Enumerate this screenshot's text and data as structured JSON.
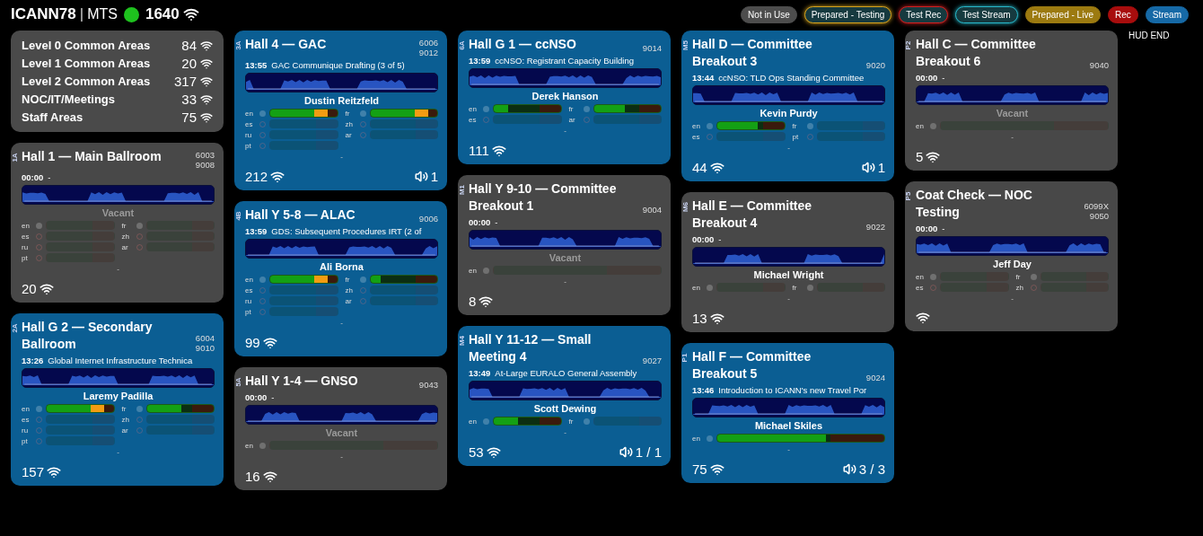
{
  "header": {
    "title": "ICANN78",
    "separator": "|",
    "subtitle": "MTS",
    "online": true,
    "count": "1640"
  },
  "legend": [
    {
      "label": "Not in Use",
      "kind": "filled",
      "color": "#4d4d4d"
    },
    {
      "label": "Prepared - Testing",
      "kind": "outlined",
      "color": "#d6a21c"
    },
    {
      "label": "Test Rec",
      "kind": "outlined",
      "color": "#d42020"
    },
    {
      "label": "Test Stream",
      "kind": "outlined",
      "color": "#27b7c9"
    },
    {
      "label": "Prepared - Live",
      "kind": "filled",
      "color": "#9c7a10"
    },
    {
      "label": "Rec",
      "kind": "filled",
      "color": "#a80d0d"
    },
    {
      "label": "Stream",
      "kind": "filled",
      "color": "#1669a6"
    }
  ],
  "summary": [
    {
      "label": "Level 0 Common Areas",
      "count": "84"
    },
    {
      "label": "Level 1 Common Areas",
      "count": "20"
    },
    {
      "label": "Level 2 Common Areas",
      "count": "317"
    },
    {
      "label": "NOC/IT/Meetings",
      "count": "33"
    },
    {
      "label": "Staff Areas",
      "count": "75"
    }
  ],
  "columns": [
    {
      "rooms": [
        {
          "code": "1A",
          "title": "Hall 1 — Main Ballroom",
          "ids": [
            "6003",
            "9008"
          ],
          "live": false,
          "time": "00:00",
          "session": "-",
          "presenter": "Vacant",
          "vacant": true,
          "channels": [
            {
              "lang": "en",
              "enabled": true
            },
            {
              "lang": "fr",
              "enabled": true
            },
            {
              "lang": "es",
              "enabled": false
            },
            {
              "lang": "zh",
              "enabled": false
            },
            {
              "lang": "ru",
              "enabled": false
            },
            {
              "lang": "ar",
              "enabled": false
            },
            {
              "lang": "pt",
              "enabled": false
            }
          ],
          "note": "-",
          "count": "20"
        },
        {
          "code": "2A",
          "title": "Hall G 2 — Secondary Ballroom",
          "ids": [
            "6004",
            "9010"
          ],
          "live": true,
          "time": "13:26",
          "session": "Global Internet Infrastructure Technica",
          "presenter": "Laremy Padilla",
          "vacant": false,
          "channels": [
            {
              "lang": "en",
              "enabled": true,
              "level": 0.66,
              "clipping": true
            },
            {
              "lang": "fr",
              "enabled": true,
              "level": 0.52
            },
            {
              "lang": "es",
              "enabled": false
            },
            {
              "lang": "zh",
              "enabled": false
            },
            {
              "lang": "ru",
              "enabled": false
            },
            {
              "lang": "ar",
              "enabled": false
            },
            {
              "lang": "pt",
              "enabled": false
            }
          ],
          "note": "-",
          "count": "157"
        }
      ]
    },
    {
      "rooms": [
        {
          "code": "3A",
          "title": "Hall 4 — GAC",
          "ids": [
            "6006",
            "9012"
          ],
          "live": true,
          "time": "13:55",
          "session": "GAC Communique Drafting (3 of 5)",
          "presenter": "Dustin Reitzfeld",
          "vacant": false,
          "channels": [
            {
              "lang": "en",
              "enabled": true,
              "level": 0.66,
              "clipping": true
            },
            {
              "lang": "fr",
              "enabled": true,
              "level": 0.66,
              "clipping": true
            },
            {
              "lang": "es",
              "enabled": false
            },
            {
              "lang": "zh",
              "enabled": false
            },
            {
              "lang": "ru",
              "enabled": false
            },
            {
              "lang": "ar",
              "enabled": false
            },
            {
              "lang": "pt",
              "enabled": false
            }
          ],
          "note": "-",
          "count": "212",
          "audio": "1"
        },
        {
          "code": "4B",
          "title": "Hall Y 5-8 — ALAC",
          "ids": [
            "9006"
          ],
          "live": true,
          "time": "13:59",
          "session": "GDS: Subsequent Procedures IRT (2 of",
          "presenter": "Ali Borna",
          "vacant": false,
          "channels": [
            {
              "lang": "en",
              "enabled": true,
              "level": 0.66,
              "clipping": true
            },
            {
              "lang": "fr",
              "enabled": true,
              "level": 0.16
            },
            {
              "lang": "es",
              "enabled": false
            },
            {
              "lang": "zh",
              "enabled": false
            },
            {
              "lang": "ru",
              "enabled": false
            },
            {
              "lang": "ar",
              "enabled": false
            },
            {
              "lang": "pt",
              "enabled": false
            }
          ],
          "note": "-",
          "count": "99"
        },
        {
          "code": "5A",
          "title": "Hall Y 1-4 — GNSO",
          "ids": [
            "9043"
          ],
          "live": false,
          "time": "00:00",
          "session": "-",
          "presenter": "Vacant",
          "vacant": true,
          "channels": [
            {
              "lang": "en",
              "enabled": true
            }
          ],
          "note": "-",
          "count": "16"
        }
      ]
    },
    {
      "rooms": [
        {
          "code": "6A",
          "title": "Hall G 1 — ccNSO",
          "ids": [
            "9014"
          ],
          "live": true,
          "time": "13:59",
          "session": "ccNSO: Registrant Capacity Building",
          "presenter": "Derek Hanson",
          "vacant": false,
          "channels": [
            {
              "lang": "en",
              "enabled": true,
              "level": 0.22
            },
            {
              "lang": "fr",
              "enabled": true,
              "level": 0.46
            },
            {
              "lang": "es",
              "enabled": false
            },
            {
              "lang": "ar",
              "enabled": false
            }
          ],
          "note": "-",
          "count": "111"
        },
        {
          "code": "M1",
          "title": "Hall Y 9-10 — Committee Breakout 1",
          "ids": [
            "9004"
          ],
          "live": false,
          "time": "00:00",
          "session": "-",
          "presenter": "Vacant",
          "vacant": true,
          "channels": [
            {
              "lang": "en",
              "enabled": true
            }
          ],
          "note": "-",
          "count": "8"
        },
        {
          "code": "M4",
          "title": "Hall Y 11-12 — Small Meeting 4",
          "ids": [
            "9027"
          ],
          "live": true,
          "time": "13:49",
          "session": "At-Large EURALO General Assembly",
          "presenter": "Scott Dewing",
          "vacant": false,
          "channels": [
            {
              "lang": "en",
              "enabled": true,
              "level": 0.36
            },
            {
              "lang": "fr",
              "enabled": true
            }
          ],
          "note": "-",
          "count": "53",
          "audio": "1 / 1"
        }
      ]
    },
    {
      "rooms": [
        {
          "code": "M5",
          "title": "Hall D — Committee Breakout 3",
          "ids": [
            "9020"
          ],
          "live": true,
          "time": "13:44",
          "session": "ccNSO: TLD Ops Standing Committee",
          "presenter": "Kevin Purdy",
          "vacant": false,
          "channels": [
            {
              "lang": "en",
              "enabled": true,
              "level": 0.6
            },
            {
              "lang": "fr",
              "enabled": true
            },
            {
              "lang": "es",
              "enabled": false
            },
            {
              "lang": "pt",
              "enabled": false
            }
          ],
          "note": "-",
          "count": "44",
          "audio": "1"
        },
        {
          "code": "M6",
          "title": "Hall E — Committee Breakout 4",
          "ids": [
            "9022"
          ],
          "live": false,
          "time": "00:00",
          "session": "-",
          "presenter": "Michael Wright",
          "vacant": false,
          "channels": [
            {
              "lang": "en",
              "enabled": true
            },
            {
              "lang": "fr",
              "enabled": true
            }
          ],
          "note": "-",
          "count": "13"
        },
        {
          "code": "P1",
          "title": "Hall F — Committee Breakout 5",
          "ids": [
            "9024"
          ],
          "live": true,
          "time": "13:46",
          "session": "Introduction to ICANN's new Travel Por",
          "presenter": "Michael Skiles",
          "vacant": false,
          "channels": [
            {
              "lang": "en",
              "enabled": true,
              "level": 0.65
            }
          ],
          "note": "-",
          "count": "75",
          "audio": "3 / 3"
        }
      ]
    },
    {
      "rooms": [
        {
          "code": "P2",
          "title": "Hall C — Committee Breakout 6",
          "ids": [
            "9040"
          ],
          "live": false,
          "time": "00:00",
          "session": "-",
          "presenter": "Vacant",
          "vacant": true,
          "channels": [
            {
              "lang": "en",
              "enabled": true
            }
          ],
          "note": "-",
          "count": "5"
        },
        {
          "code": "P5",
          "title": "Coat Check — NOC Testing",
          "ids": [
            "6099X",
            "9050"
          ],
          "live": false,
          "time": "00:00",
          "session": "-",
          "presenter": "Jeff Day",
          "vacant": false,
          "channels": [
            {
              "lang": "en",
              "enabled": true
            },
            {
              "lang": "fr",
              "enabled": true
            },
            {
              "lang": "es",
              "enabled": false
            },
            {
              "lang": "zh",
              "enabled": false
            }
          ],
          "note": "-"
        }
      ]
    }
  ],
  "hud_end_label": "HUD END"
}
